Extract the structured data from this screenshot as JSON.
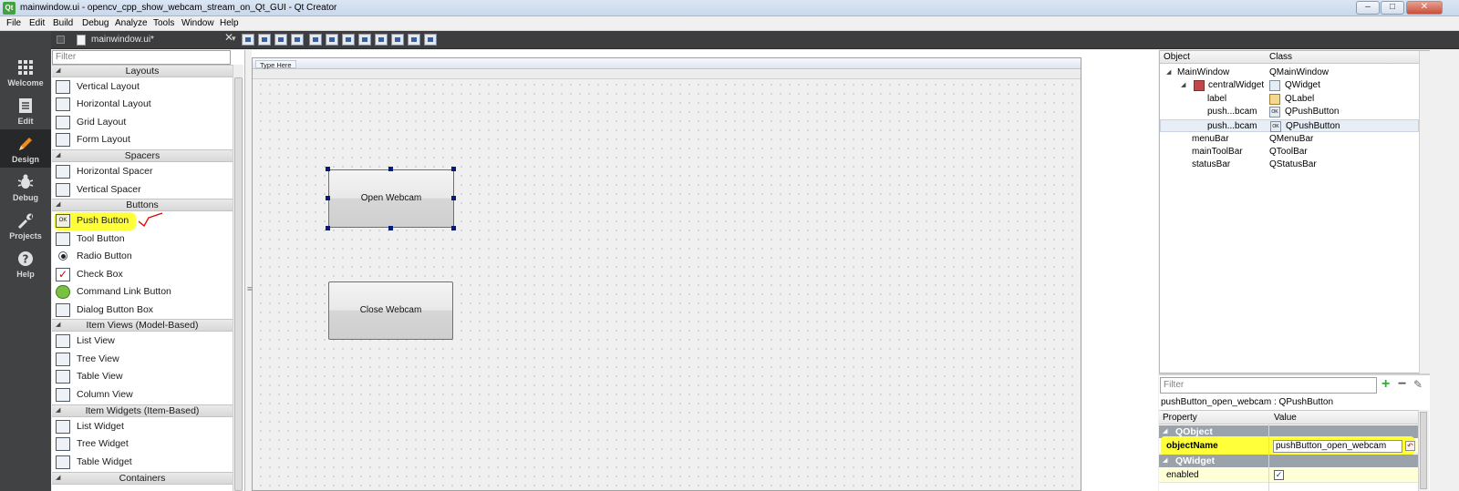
{
  "window": {
    "logo": "Qt",
    "title": "mainwindow.ui - opencv_cpp_show_webcam_stream_on_Qt_GUI - Qt Creator",
    "controls": {
      "minimize": "–",
      "maximize": "□",
      "close": "✕"
    }
  },
  "menu": [
    "File",
    "Edit",
    "Build",
    "Debug",
    "Analyze",
    "Tools",
    "Window",
    "Help"
  ],
  "modes": [
    {
      "label": "Welcome",
      "icon": "grid-icon"
    },
    {
      "label": "Edit",
      "icon": "document-icon"
    },
    {
      "label": "Design",
      "icon": "pencil-icon",
      "active": true
    },
    {
      "label": "Debug",
      "icon": "bug-icon"
    },
    {
      "label": "Projects",
      "icon": "wrench-icon"
    },
    {
      "label": "Help",
      "icon": "question-icon"
    }
  ],
  "editor": {
    "document": "mainwindow.ui*",
    "dropdown": "▾",
    "close": "✕"
  },
  "widgetbox": {
    "filter_placeholder": "Filter",
    "categories": {
      "layouts": "Layouts",
      "spacers": "Spacers",
      "buttons": "Buttons",
      "item_views": "Item Views (Model-Based)",
      "item_widgets": "Item Widgets (Item-Based)",
      "containers": "Containers"
    },
    "items": {
      "vertical_layout": "Vertical Layout",
      "horizontal_layout": "Horizontal Layout",
      "grid_layout": "Grid Layout",
      "form_layout": "Form Layout",
      "horizontal_spacer": "Horizontal Spacer",
      "vertical_spacer": "Vertical Spacer",
      "push_button": "Push Button",
      "push_button_icon": "OK",
      "tool_button": "Tool Button",
      "radio_button": "Radio Button",
      "check_box": "Check Box",
      "command_link_button": "Command Link Button",
      "dialog_button_box": "Dialog Button Box",
      "list_view": "List View",
      "tree_view": "Tree View",
      "table_view": "Table View",
      "column_view": "Column View",
      "list_widget": "List Widget",
      "tree_widget": "Tree Widget",
      "table_widget": "Table Widget"
    }
  },
  "form": {
    "menubar_placeholder": "Type Here",
    "buttons": {
      "open": "Open Webcam",
      "close": "Close Webcam"
    }
  },
  "object_inspector": {
    "columns": [
      "Object",
      "Class"
    ],
    "rows": [
      {
        "object": "MainWindow",
        "class": "QMainWindow"
      },
      {
        "object": "centralWidget",
        "class": "QWidget"
      },
      {
        "object": "label",
        "class": "QLabel"
      },
      {
        "object": "push...bcam",
        "class": "QPushButton"
      },
      {
        "object": "push...bcam",
        "class": "QPushButton"
      },
      {
        "object": "menuBar",
        "class": "QMenuBar"
      },
      {
        "object": "mainToolBar",
        "class": "QToolBar"
      },
      {
        "object": "statusBar",
        "class": "QStatusBar"
      }
    ],
    "class_icons": {
      "button": "OK"
    }
  },
  "property_editor": {
    "filter_placeholder": "Filter",
    "selected": "pushButton_open_webcam : QPushButton",
    "columns": [
      "Property",
      "Value"
    ],
    "groups": {
      "qobject": "QObject",
      "qwidget": "QWidget"
    },
    "rows": {
      "object_name": {
        "name": "objectName",
        "value": "pushButton_open_webcam"
      },
      "enabled": {
        "name": "enabled",
        "checked": true
      }
    },
    "check_mark": "✓",
    "reset": "↶"
  },
  "colors": {
    "highlight": "#ffff3a",
    "modebar": "#404244",
    "annotation": "#e00000",
    "selection_handle": "#0a1a7a"
  }
}
